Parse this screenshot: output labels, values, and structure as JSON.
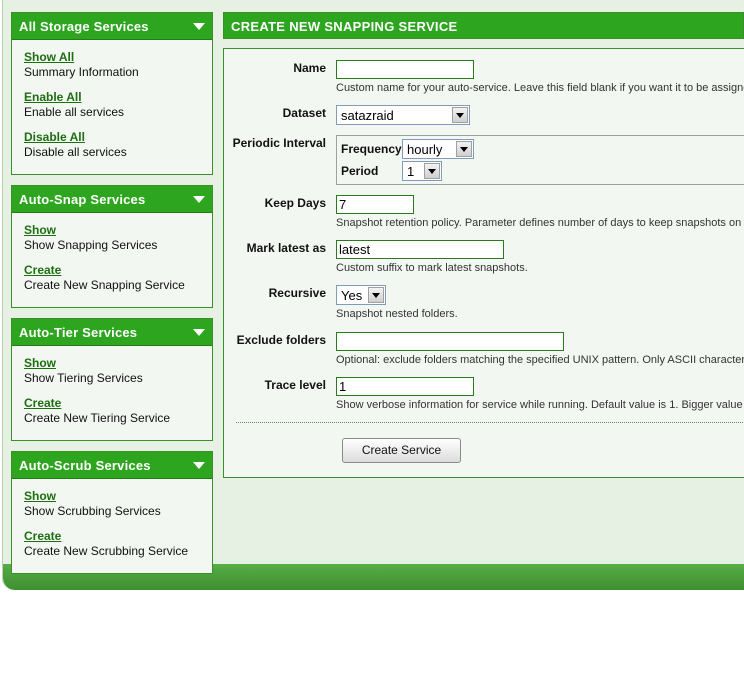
{
  "sidebar": {
    "sections": [
      {
        "title": "All Storage Services",
        "items": [
          {
            "link": "Show All",
            "desc": "Summary Information"
          },
          {
            "link": "Enable All",
            "desc": "Enable all services"
          },
          {
            "link": "Disable All",
            "desc": "Disable all services"
          }
        ]
      },
      {
        "title": "Auto-Snap Services",
        "items": [
          {
            "link": "Show",
            "desc": "Show Snapping Services"
          },
          {
            "link": "Create",
            "desc": "Create New Snapping Service"
          }
        ]
      },
      {
        "title": "Auto-Tier Services",
        "items": [
          {
            "link": "Show",
            "desc": "Show Tiering Services"
          },
          {
            "link": "Create",
            "desc": "Create New Tiering Service"
          }
        ]
      },
      {
        "title": "Auto-Scrub Services",
        "items": [
          {
            "link": "Show",
            "desc": "Show Scrubbing Services"
          },
          {
            "link": "Create",
            "desc": "Create New Scrubbing Service"
          }
        ]
      }
    ]
  },
  "main": {
    "title": "CREATE NEW SNAPPING SERVICE",
    "form": {
      "name": {
        "label": "Name",
        "value": "",
        "hint": "Custom name for your auto-service. Leave this field blank if you want it to be assigned"
      },
      "dataset": {
        "label": "Dataset",
        "value": "satazraid"
      },
      "interval": {
        "label": "Periodic Interval",
        "frequency_label": "Frequency",
        "frequency_value": "hourly",
        "period_label": "Period",
        "period_value": "1"
      },
      "keep_days": {
        "label": "Keep Days",
        "value": "7",
        "hint": "Snapshot retention policy. Parameter defines number of days to keep snapshots on t"
      },
      "mark_latest": {
        "label": "Mark latest as",
        "value": "latest",
        "hint": "Custom suffix to mark latest snapshots."
      },
      "recursive": {
        "label": "Recursive",
        "value": "Yes",
        "hint": "Snapshot nested folders."
      },
      "exclude": {
        "label": "Exclude folders",
        "value": "",
        "hint": "Optional: exclude folders matching the specified UNIX pattern. Only ASCII characters"
      },
      "trace": {
        "label": "Trace level",
        "value": "1",
        "hint": "Show verbose information for service while running. Default value is 1. Bigger value"
      }
    },
    "submit_label": "Create Service"
  },
  "colors": {
    "header_green": "#2da51f",
    "link_green": "#1e6e12",
    "panel_bg": "#f3f7f2",
    "page_bg": "#e6f0e3"
  }
}
